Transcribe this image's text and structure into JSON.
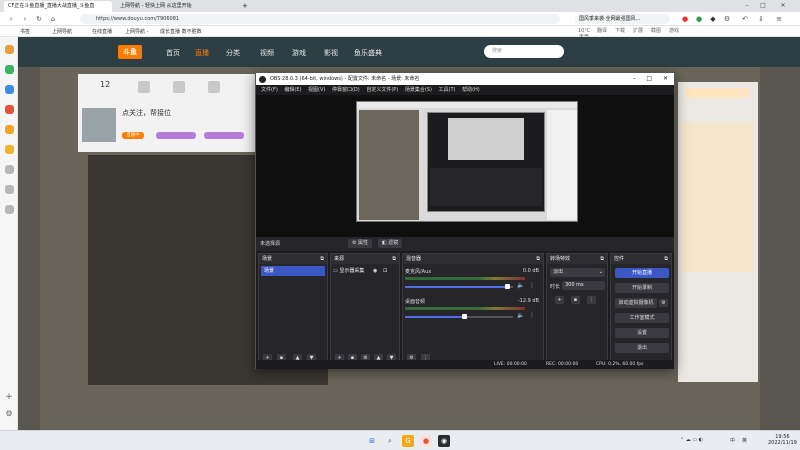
{
  "browser": {
    "tabs": [
      {
        "label": "CF正在斗鱼直播_直播大战直播_斗鱼直",
        "active": true
      },
      {
        "label": "上网导航 - 轻快上网 从这里开始",
        "active": false
      }
    ],
    "url": "https://www.douyu.com/7906081",
    "search_hint": "国风季来袭·全网最强国风...",
    "bookmarks": [
      "书签",
      "上网导航",
      "在线直播",
      "上网导航 -",
      "成长直播 数不胜数"
    ],
    "tool_labels": [
      "10°C 天气",
      "翻译",
      "下载",
      "扩展",
      "截图",
      "游戏"
    ]
  },
  "douyu": {
    "logo": "斗鱼",
    "nav": [
      "首页",
      "直播",
      "分类",
      "视频",
      "游戏",
      "影视",
      "鱼乐盛典"
    ],
    "search_placeholder": "搜索",
    "room": {
      "title": "点关注，帮接位",
      "followers": "12",
      "tag": "直播中"
    }
  },
  "obs": {
    "title": "OBS 28.0.3 (64-bit, windows) - 配置文件: 未命名 - 场景: 未命名",
    "menu": [
      "文件(F)",
      "编辑(E)",
      "视图(V)",
      "停靠窗口(D)",
      "自定义文件(P)",
      "场景集合(S)",
      "工具(T)",
      "帮助(H)"
    ],
    "source_bar": {
      "label": "未选择源",
      "properties": "属性",
      "filters": "滤镜"
    },
    "docks": {
      "scenes": {
        "title": "场景",
        "items": [
          "场景"
        ]
      },
      "sources": {
        "title": "来源",
        "items": [
          "显示器采集"
        ]
      },
      "mixer": {
        "title": "混音器",
        "channels": [
          {
            "name": "麦克风/Aux",
            "db": "0.0 dB",
            "level": 0.94
          },
          {
            "name": "桌面音频",
            "db": "-12.9 dB",
            "level": 0.55
          }
        ]
      },
      "transitions": {
        "title": "转场特效",
        "type": "淡出",
        "duration_label": "时长",
        "duration": "300 ms"
      },
      "controls": {
        "title": "控件",
        "buttons": [
          "开始直播",
          "开始录制",
          "启动虚拟摄像机",
          "工作室模式",
          "设置",
          "退出"
        ]
      }
    },
    "status": {
      "live": "LIVE: 00:00:00",
      "rec": "REC: 00:00:00",
      "cpu": "CPU: 0.2%, 60.00 fps"
    }
  },
  "taskbar": {
    "tray": [
      "中",
      "英"
    ],
    "time": "19:56",
    "date": "2022/11/19"
  },
  "colors": {
    "obs_accent": "#3b57c4",
    "douyu_orange": "#ff7a00"
  }
}
